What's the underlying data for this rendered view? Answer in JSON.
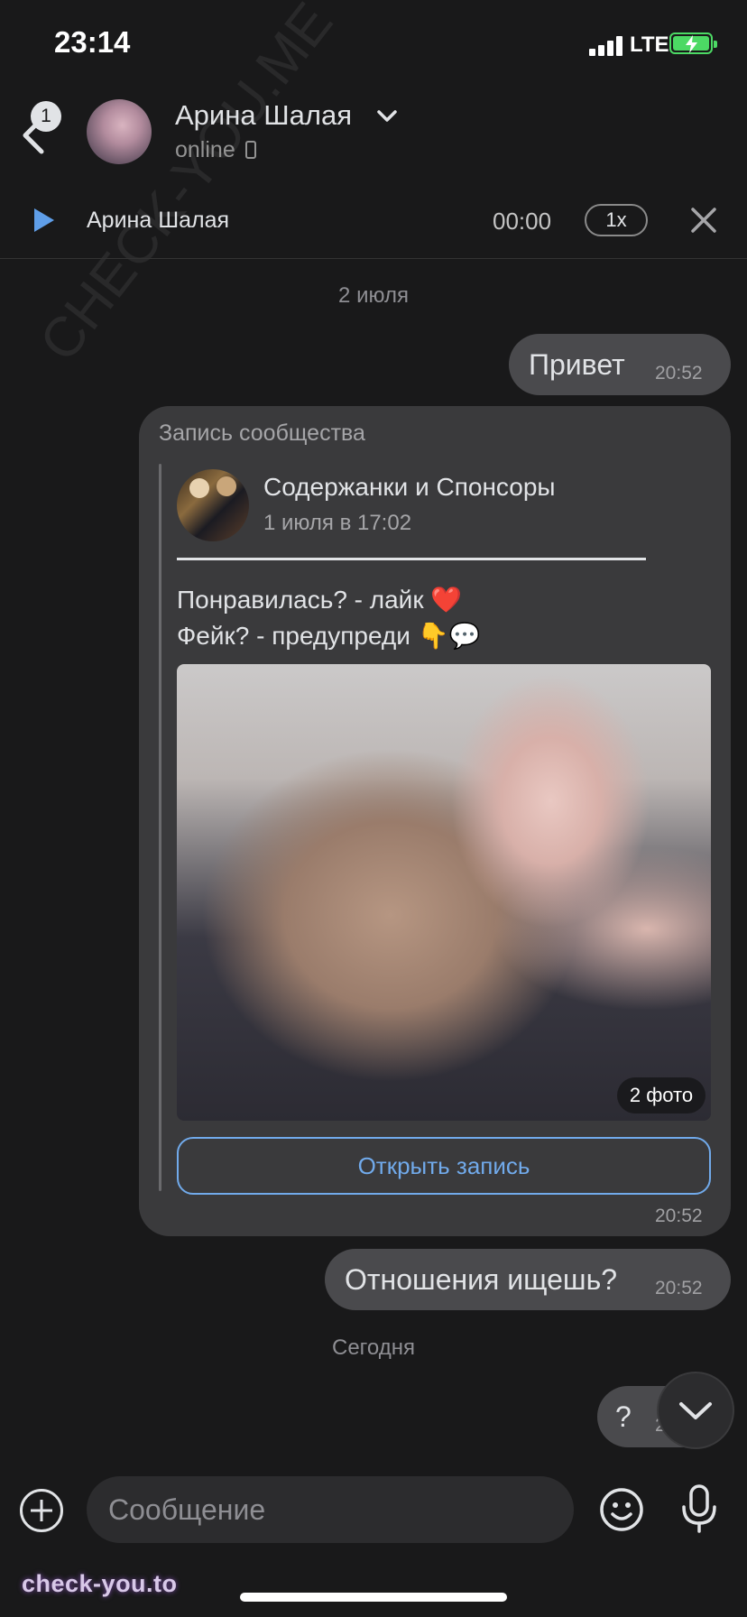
{
  "status_bar": {
    "time": "23:14",
    "network": "LTE",
    "signal_icon": "signal-bars-icon",
    "battery_icon": "battery-charging-icon"
  },
  "header": {
    "back_icon": "chevron-left-icon",
    "unread_badge": "1",
    "contact_name": "Арина Шалая",
    "name_dropdown_icon": "chevron-down-icon",
    "status": "online",
    "status_device_icon": "phone-icon"
  },
  "audio_player": {
    "play_icon": "play-icon",
    "title": "Арина Шалая",
    "time": "00:00",
    "speed": "1x",
    "close_icon": "close-icon"
  },
  "messages": {
    "date_1": "2 июля",
    "msg_1": {
      "text": "Привет",
      "time": "20:52"
    },
    "shared_post": {
      "label": "Запись сообщества",
      "group_name": "Содержанки и Спонсоры",
      "post_date": "1 июля в 17:02",
      "text_line_1": "Понравилась? - лайк ❤️",
      "text_line_2": "Фейк? - предупреди 👇💬",
      "photo_count": "2 фото",
      "open_button": "Открыть запись",
      "time": "20:52"
    },
    "msg_2": {
      "text": "Отношения ищешь?",
      "time": "20:52"
    },
    "date_2": "Сегодня",
    "msg_3": {
      "text": "?",
      "time": "2"
    }
  },
  "scroll_down_icon": "chevron-down-icon",
  "composer": {
    "attach_icon": "plus-circle-icon",
    "placeholder": "Сообщение",
    "emoji_icon": "smiley-icon",
    "mic_icon": "microphone-icon"
  },
  "watermark": {
    "bottom": "check-you.to",
    "diagonal": "CHECK-YOU.ME"
  },
  "colors": {
    "accent": "#71aaeb",
    "background": "#19191a",
    "bubble": "#4a4a4d",
    "battery": "#4cd964"
  }
}
